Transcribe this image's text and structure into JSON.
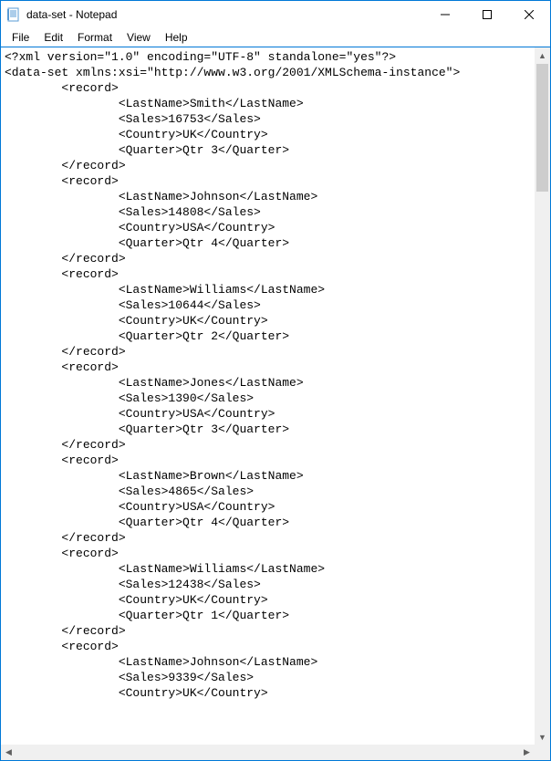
{
  "window": {
    "title": "data-set - Notepad"
  },
  "menu": {
    "file": "File",
    "edit": "Edit",
    "format": "Format",
    "view": "View",
    "help": "Help"
  },
  "xml": {
    "declaration": "<?xml version=\"1.0\" encoding=\"UTF-8\" standalone=\"yes\"?>",
    "root_open": "<data-set xmlns:xsi=\"http://www.w3.org/2001/XMLSchema-instance\">",
    "records": [
      {
        "LastName": "Smith",
        "Sales": "16753",
        "Country": "UK",
        "Quarter": "Qtr 3",
        "complete": true
      },
      {
        "LastName": "Johnson",
        "Sales": "14808",
        "Country": "USA",
        "Quarter": "Qtr 4",
        "complete": true
      },
      {
        "LastName": "Williams",
        "Sales": "10644",
        "Country": "UK",
        "Quarter": "Qtr 2",
        "complete": true
      },
      {
        "LastName": "Jones",
        "Sales": "1390",
        "Country": "USA",
        "Quarter": "Qtr 3",
        "complete": true
      },
      {
        "LastName": "Brown",
        "Sales": "4865",
        "Country": "USA",
        "Quarter": "Qtr 4",
        "complete": true
      },
      {
        "LastName": "Williams",
        "Sales": "12438",
        "Country": "UK",
        "Quarter": "Qtr 1",
        "complete": true
      },
      {
        "LastName": "Johnson",
        "Sales": "9339",
        "Country": "UK",
        "Quarter": null,
        "complete": false
      }
    ],
    "indent_record": "        ",
    "indent_field": "                "
  }
}
